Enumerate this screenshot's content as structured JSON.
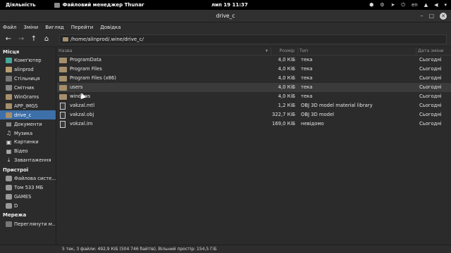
{
  "topbar": {
    "activities": "Діяльність",
    "app_name": "Файловий менеджер Thunar",
    "clock": "лип 19  11:37",
    "lang": "en"
  },
  "window": {
    "title": "drive_c"
  },
  "menu": [
    "Файл",
    "Зміни",
    "Вигляд",
    "Перейти",
    "Довідка"
  ],
  "toolbar": {
    "path": "/home/alinprod/.wine/drive_c/"
  },
  "sidebar": {
    "places_heading": "Місця",
    "places": [
      {
        "label": "Комп'ютер",
        "icon": "computer-icon"
      },
      {
        "label": "alinprod",
        "icon": "home-icon"
      },
      {
        "label": "Стільниця",
        "icon": "desktop-icon"
      },
      {
        "label": "Смітник",
        "icon": "trash-icon"
      },
      {
        "label": "WinGrams",
        "icon": "folder-icon"
      },
      {
        "label": "APP_IMGS",
        "icon": "folder-icon"
      },
      {
        "label": "drive_c",
        "icon": "folder-icon",
        "active": true
      },
      {
        "label": "Документи",
        "icon": "document-icon"
      },
      {
        "label": "Музика",
        "icon": "music-icon"
      },
      {
        "label": "Картинки",
        "icon": "pictures-icon"
      },
      {
        "label": "Відео",
        "icon": "video-icon"
      },
      {
        "label": "Завантаження",
        "icon": "download-icon"
      }
    ],
    "devices_heading": "Пристрої",
    "devices": [
      {
        "label": "Файлова систе...",
        "icon": "drive-icon"
      },
      {
        "label": "Том 533 МБ",
        "icon": "drive-icon"
      },
      {
        "label": "GAMES",
        "icon": "drive-icon"
      },
      {
        "label": "D",
        "icon": "drive-icon"
      }
    ],
    "network_heading": "Мережа",
    "network": [
      {
        "label": "Переглянути м...",
        "icon": "network-icon"
      }
    ]
  },
  "columns": {
    "name": "Назва",
    "size": "Розмір",
    "type": "Тип",
    "date": "Дата зміни"
  },
  "files": [
    {
      "name": "ProgramData",
      "size": "4,0 КіБ",
      "type": "тека",
      "date": "Сьогодні",
      "kind": "folder"
    },
    {
      "name": "Program Files",
      "size": "4,0 КіБ",
      "type": "тека",
      "date": "Сьогодні",
      "kind": "folder"
    },
    {
      "name": "Program Files (x86)",
      "size": "4,0 КіБ",
      "type": "тека",
      "date": "Сьогодні",
      "kind": "folder"
    },
    {
      "name": "users",
      "size": "4,0 КіБ",
      "type": "тека",
      "date": "Сьогодні",
      "kind": "folder"
    },
    {
      "name": "windows",
      "size": "4,0 КіБ",
      "type": "тека",
      "date": "Сьогодні",
      "kind": "folder"
    },
    {
      "name": "vakzal.mtl",
      "size": "1,2 КіБ",
      "type": "OBJ 3D model material library",
      "date": "Сьогодні",
      "kind": "file"
    },
    {
      "name": "vakzal.obj",
      "size": "322,7 КіБ",
      "type": "OBJ 3D model",
      "date": "Сьогодні",
      "kind": "file"
    },
    {
      "name": "vokzal.im",
      "size": "169,0 КіБ",
      "type": "невідомо",
      "date": "Сьогодні",
      "kind": "file"
    }
  ],
  "status": "5 тек, 3 файли: 492,9 КіБ (504 746 байтів), Вільний простір: 154,5 ГіБ"
}
